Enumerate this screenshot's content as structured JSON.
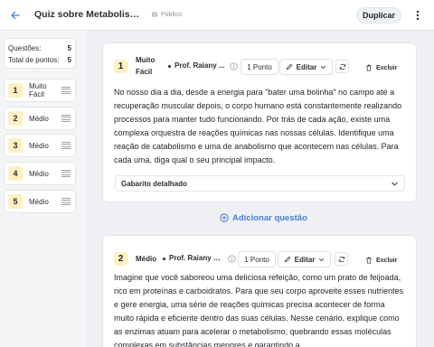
{
  "header": {
    "title": "Quiz sobre Metabolismo Ce...",
    "visibility": "Público",
    "duplicate_label": "Duplicar"
  },
  "sidebar": {
    "questions_label": "Questões:",
    "questions_value": "5",
    "points_label": "Total de pontos:",
    "points_value": "5",
    "items": [
      {
        "num": "1",
        "label": "Muito Fácil"
      },
      {
        "num": "2",
        "label": "Médio"
      },
      {
        "num": "3",
        "label": "Médio"
      },
      {
        "num": "4",
        "label": "Médio"
      },
      {
        "num": "5",
        "label": "Médio"
      }
    ]
  },
  "questions": [
    {
      "num": "1",
      "difficulty_line1": "Muito",
      "difficulty_line2": "Fácil",
      "author": "Prof. Raiany ...",
      "points": "1 Ponto",
      "edit_label": "Editar",
      "delete_label": "Excluir",
      "text": "No nosso dia a dia, desde a energia para \"bater uma bolinha\" no campo até a recuperação muscular depois, o corpo humano está constantemente realizando processos para manter tudo funcionando. Por trás de cada ação, existe uma complexa orquestra de reações químicas nas nossas células. Identifique uma reação de catabolismo e uma de anabolismo que acontecem nas células. Para cada uma, diga qual o seu principal impacto.",
      "answer_key_label": "Gabarito detalhado"
    },
    {
      "num": "2",
      "difficulty": "Médio",
      "author": "Prof. Raiany M...",
      "points": "1 Ponto",
      "edit_label": "Editar",
      "delete_label": "Excluir",
      "text": "Imagine que você saboreou uma deliciosa refeição, como um prato de feijoada, rico em proteínas e carboidratos. Para que seu corpo aproveite esses nutrientes e gere energia, uma série de reações químicas precisa acontecer de forma muito rápida e eficiente dentro das suas células. Nesse cenário, explique como as enzimas atuam para acelerar o metabolismo, quebrando essas moléculas complexas em substâncias menores e garantindo a"
    }
  ],
  "add_question_label": "Adicionar questão",
  "colors": {
    "accent": "#4a7fd4",
    "badge": "#fdf0c2"
  }
}
